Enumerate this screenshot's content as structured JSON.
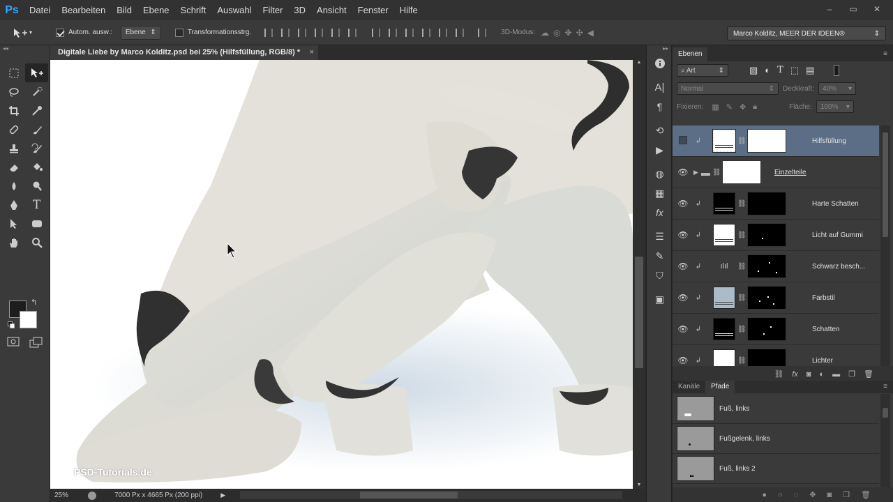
{
  "app": {
    "logo": "Ps"
  },
  "menu": [
    "Datei",
    "Bearbeiten",
    "Bild",
    "Ebene",
    "Schrift",
    "Auswahl",
    "Filter",
    "3D",
    "Ansicht",
    "Fenster",
    "Hilfe"
  ],
  "window_buttons": [
    "–",
    "▭",
    "✕"
  ],
  "options": {
    "auto_select_label": "Autom. ausw.:",
    "auto_select_checked": true,
    "auto_select_value": "Ebene",
    "transform_label": "Transformationsstrg.",
    "transform_checked": false,
    "mode3d_label": "3D-Modus:",
    "workspace": "Marco Kolditz, MEER DER IDEEN®"
  },
  "document": {
    "tab_title": "Digitale Liebe by Marco Kolditz.psd bei 25% (Hilfsfüllung, RGB/8) *",
    "close": "×",
    "watermark": "PSD-Tutorials.de"
  },
  "status": {
    "zoom": "25%",
    "doc_info": "7000 Px x 4665 Px (200 ppi)"
  },
  "swatches": {
    "foreground": "#1d1d1d",
    "background": "#ffffff"
  },
  "layers_panel": {
    "tab": "Ebenen",
    "filter_kind": "Art",
    "blend_mode": "Normal",
    "opacity_label": "Deckkraft:",
    "opacity_value": "40%",
    "lock_label": "Fixieren:",
    "fill_label": "Fläche:",
    "fill_value": "100%",
    "layers": [
      {
        "name": "Hilfsfüllung",
        "selected": true,
        "visible": false
      },
      {
        "name": "Einzelteile",
        "group": true,
        "visible": true
      },
      {
        "name": "Harte Schatten",
        "visible": true
      },
      {
        "name": "Licht auf Gummi",
        "visible": true
      },
      {
        "name": "Schwarz besch...",
        "visible": true
      },
      {
        "name": "Farbstil",
        "visible": true
      },
      {
        "name": "Schatten",
        "visible": true
      },
      {
        "name": "Lichter",
        "visible": true
      }
    ]
  },
  "paths_panel": {
    "tabs": [
      "Kanäle",
      "Pfade"
    ],
    "paths": [
      "Fuß, links",
      "Fußgelenk, links",
      "Fuß, links 2"
    ]
  }
}
